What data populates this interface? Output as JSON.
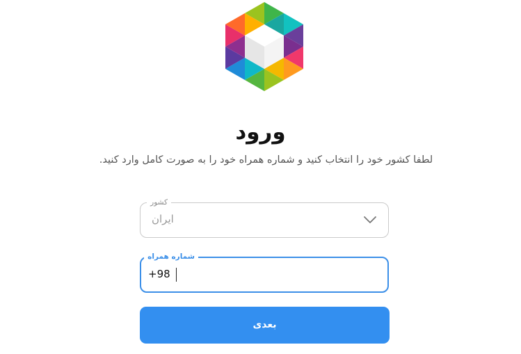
{
  "header": {
    "title": "ورود",
    "subtitle": "لطفا کشور خود را انتخاب کنید و شماره همراه خود را به صورت کامل وارد کنید."
  },
  "country_field": {
    "label": "کشور",
    "value": "ایران"
  },
  "phone_field": {
    "label": "شماره همراه",
    "prefix": "+98",
    "value": ""
  },
  "submit_button": {
    "label": "بعدی"
  },
  "colors": {
    "accent": "#338ff0",
    "focus_border": "#3b8fe8"
  },
  "icons": [
    "app-logo-icon",
    "chevron-down-icon"
  ]
}
